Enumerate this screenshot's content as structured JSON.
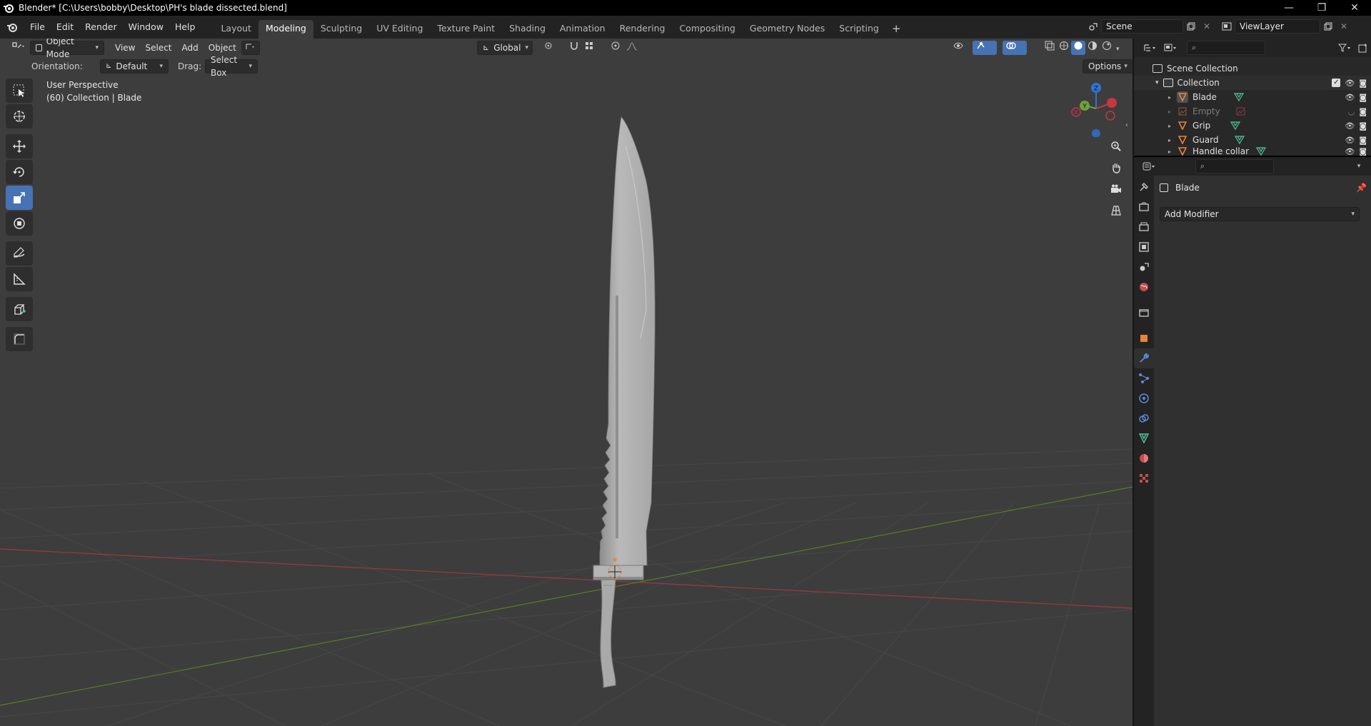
{
  "window": {
    "title": "Blender* [C:\\Users\\bobby\\Desktop\\PH's blade dissected.blend]",
    "minimize": "—",
    "maximize": "❐",
    "close": "✕"
  },
  "menu": [
    "File",
    "Edit",
    "Render",
    "Window",
    "Help"
  ],
  "workspaces": [
    "Layout",
    "Modeling",
    "Sculpting",
    "UV Editing",
    "Texture Paint",
    "Shading",
    "Animation",
    "Rendering",
    "Compositing",
    "Geometry Nodes",
    "Scripting"
  ],
  "active_workspace": "Modeling",
  "add_workspace": "+",
  "scene": {
    "name": "Scene",
    "view_layer": "ViewLayer"
  },
  "viewport_header": {
    "mode": "Object Mode",
    "menus": [
      "View",
      "Select",
      "Add",
      "Object"
    ],
    "transform_orientation": "Global"
  },
  "tool_settings": {
    "orientation_label": "Orientation:",
    "orientation_value": "Default",
    "drag_label": "Drag:",
    "drag_value": "Select Box",
    "options": "Options"
  },
  "viewport_info": {
    "perspective": "User Perspective",
    "collection": "(60) Collection | Blade"
  },
  "gizmo": {
    "z": "Z",
    "y": "Y",
    "x": "X"
  },
  "outliner": {
    "root": "Scene Collection",
    "collection": "Collection",
    "items": [
      {
        "name": "Blade",
        "dim": false
      },
      {
        "name": "Empty",
        "dim": true
      },
      {
        "name": "Grip",
        "dim": false
      },
      {
        "name": "Guard",
        "dim": false
      },
      {
        "name": "Handle collar",
        "dim": false
      }
    ]
  },
  "properties": {
    "object_name": "Blade",
    "add_modifier": "Add Modifier"
  },
  "colors": {
    "accent": "#4772b3",
    "viewport_bg": "#3d3d3d",
    "panel_bg": "#303030",
    "object_orange": "#e8843c",
    "mesh_green": "#52c49b",
    "x_axis": "#c8373f",
    "y_axis": "#6da33a",
    "z_axis": "#2e74d6"
  }
}
